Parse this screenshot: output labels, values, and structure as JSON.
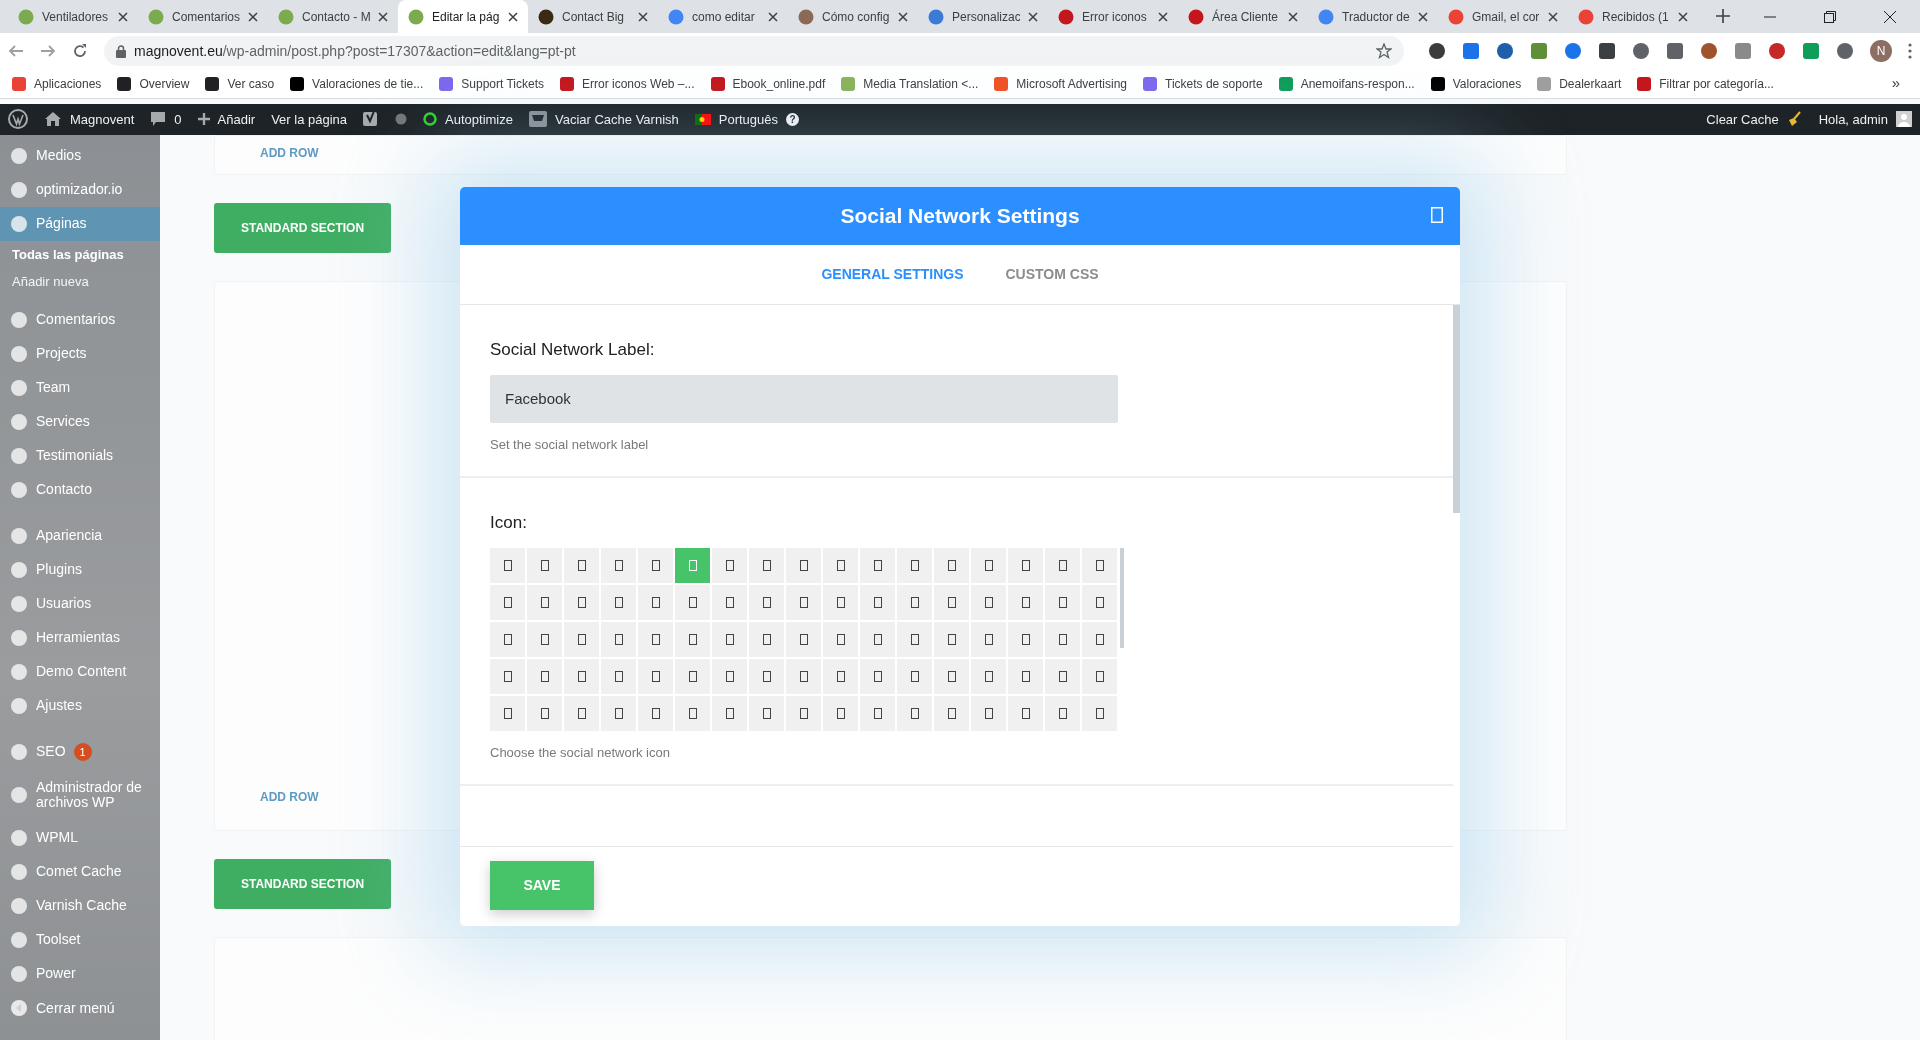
{
  "browser": {
    "tabs": [
      {
        "title": "Ventiladores",
        "selected": false,
        "color": "#7cab4f"
      },
      {
        "title": "Comentarios",
        "selected": false,
        "color": "#7cab4f"
      },
      {
        "title": "Contacto - M",
        "selected": false,
        "color": "#7cab4f"
      },
      {
        "title": "Editar la pág",
        "selected": true,
        "color": "#7cab4f"
      },
      {
        "title": "Contact Big",
        "selected": false,
        "color": "#3b2a12"
      },
      {
        "title": "como editar",
        "selected": false,
        "color": "#4285f4"
      },
      {
        "title": "Cómo config",
        "selected": false,
        "color": "#8a6a55"
      },
      {
        "title": "Personalizac",
        "selected": false,
        "color": "#3a7bd5"
      },
      {
        "title": "Error iconos",
        "selected": false,
        "color": "#c4161c"
      },
      {
        "title": "Área Cliente",
        "selected": false,
        "color": "#c4161c"
      },
      {
        "title": "Traductor de",
        "selected": false,
        "color": "#4285f4"
      },
      {
        "title": "Gmail, el cor",
        "selected": false,
        "color": "#ea4335"
      },
      {
        "title": "Recibidos (1",
        "selected": false,
        "color": "#ea4335"
      }
    ],
    "address": {
      "domain": "magnovent.eu",
      "path": "/wp-admin/post.php?post=17307&action=edit&lang=pt-pt"
    },
    "profile_initial": "N",
    "bookmarks": [
      {
        "label": "Aplicaciones",
        "color": "#ea4335"
      },
      {
        "label": "Overview",
        "color": "#202124"
      },
      {
        "label": "Ver caso",
        "color": "#202124"
      },
      {
        "label": "Valoraciones de tie...",
        "color": "#000000"
      },
      {
        "label": "Support Tickets",
        "color": "#7b68ee"
      },
      {
        "label": "Error iconos Web –...",
        "color": "#c4161c"
      },
      {
        "label": "Ebook_online.pdf",
        "color": "#c4161c"
      },
      {
        "label": "Media Translation <...",
        "color": "#8bb35a"
      },
      {
        "label": "Microsoft Advertising",
        "color": "#f25022"
      },
      {
        "label": "Tickets de soporte",
        "color": "#7b68ee"
      },
      {
        "label": "Anemoifans-respon...",
        "color": "#0f9d58"
      },
      {
        "label": "Valoraciones",
        "color": "#000000"
      },
      {
        "label": "Dealerkaart",
        "color": "#9e9e9e"
      },
      {
        "label": "Filtrar por categoría...",
        "color": "#c4161c"
      }
    ],
    "bookmarks_more": "»"
  },
  "admin_bar": {
    "site": "Magnovent",
    "comments": "0",
    "new": "Añadir",
    "view": "Ver la página",
    "autoptimize": "Autoptimize",
    "varnish": "Vaciar Cache Varnish",
    "language": "Português",
    "help": "?",
    "clear_cache": "Clear Cache",
    "greeting": "Hola, admin"
  },
  "sidebar": {
    "groups": [
      [
        {
          "label": "Medios",
          "selected": false
        },
        {
          "label": "optimizador.io",
          "selected": false
        },
        {
          "label": "Páginas",
          "selected": true,
          "children": [
            {
              "label": "Todas las páginas",
              "selected": true
            },
            {
              "label": "Añadir nueva",
              "selected": false
            }
          ]
        },
        {
          "label": "Comentarios",
          "selected": false
        },
        {
          "label": "Projects",
          "selected": false
        },
        {
          "label": "Team",
          "selected": false
        },
        {
          "label": "Services",
          "selected": false
        },
        {
          "label": "Testimonials",
          "selected": false
        },
        {
          "label": "Contacto",
          "selected": false
        }
      ],
      [
        {
          "label": "Apariencia",
          "selected": false
        },
        {
          "label": "Plugins",
          "selected": false
        },
        {
          "label": "Usuarios",
          "selected": false
        },
        {
          "label": "Herramientas",
          "selected": false
        },
        {
          "label": "Demo Content",
          "selected": false
        },
        {
          "label": "Ajustes",
          "selected": false
        }
      ],
      [
        {
          "label": "SEO",
          "selected": false,
          "badge": "1"
        },
        {
          "label": "Administrador de archivos WP",
          "selected": false
        },
        {
          "label": "WPML",
          "selected": false
        },
        {
          "label": "Comet Cache",
          "selected": false
        },
        {
          "label": "Varnish Cache",
          "selected": false
        },
        {
          "label": "Toolset",
          "selected": false
        },
        {
          "label": "Power",
          "selected": false
        }
      ]
    ],
    "collapse": "Cerrar menú"
  },
  "builder": {
    "items": [
      {
        "kind": "row_card",
        "label": "ADD ROW"
      },
      {
        "kind": "section_button",
        "label": "STANDARD SECTION"
      },
      {
        "kind": "section_card",
        "label": "ADD ROW"
      },
      {
        "kind": "section_button",
        "label": "STANDARD SECTION"
      },
      {
        "kind": "empty_card"
      }
    ]
  },
  "modal": {
    "title": "Social Network Settings",
    "tabs": [
      {
        "label": "GENERAL SETTINGS",
        "selected": true
      },
      {
        "label": "CUSTOM CSS",
        "selected": false
      }
    ],
    "fields": [
      {
        "kind": "text",
        "label": "Social Network Label:",
        "value": "Facebook",
        "hint": "Set the social network label"
      },
      {
        "kind": "icon_picker",
        "label": "Icon:",
        "hint": "Choose the social network icon",
        "rows": [
          [
            {
              "selected": false
            },
            {
              "selected": false
            },
            {
              "selected": false
            },
            {
              "selected": false
            },
            {
              "selected": false
            },
            {
              "selected": true
            },
            {
              "selected": false
            },
            {
              "selected": false
            },
            {
              "selected": false
            },
            {
              "selected": false
            },
            {
              "selected": false
            },
            {
              "selected": false
            },
            {
              "selected": false
            },
            {
              "selected": false
            },
            {
              "selected": false
            },
            {
              "selected": false
            },
            {
              "selected": false
            }
          ],
          [
            {
              "selected": false
            },
            {
              "selected": false
            },
            {
              "selected": false
            },
            {
              "selected": false
            },
            {
              "selected": false
            },
            {
              "selected": false
            },
            {
              "selected": false
            },
            {
              "selected": false
            },
            {
              "selected": false
            },
            {
              "selected": false
            },
            {
              "selected": false
            },
            {
              "selected": false
            },
            {
              "selected": false
            },
            {
              "selected": false
            },
            {
              "selected": false
            },
            {
              "selected": false
            },
            {
              "selected": false
            }
          ],
          [
            {
              "selected": false
            },
            {
              "selected": false
            },
            {
              "selected": false
            },
            {
              "selected": false
            },
            {
              "selected": false
            },
            {
              "selected": false
            },
            {
              "selected": false
            },
            {
              "selected": false
            },
            {
              "selected": false
            },
            {
              "selected": false
            },
            {
              "selected": false
            },
            {
              "selected": false
            },
            {
              "selected": false
            },
            {
              "selected": false
            },
            {
              "selected": false
            },
            {
              "selected": false
            },
            {
              "selected": false
            }
          ],
          [
            {
              "selected": false
            },
            {
              "selected": false
            },
            {
              "selected": false
            },
            {
              "selected": false
            },
            {
              "selected": false
            },
            {
              "selected": false
            },
            {
              "selected": false
            },
            {
              "selected": false
            },
            {
              "selected": false
            },
            {
              "selected": false
            },
            {
              "selected": false
            },
            {
              "selected": false
            },
            {
              "selected": false
            },
            {
              "selected": false
            },
            {
              "selected": false
            },
            {
              "selected": false
            },
            {
              "selected": false
            }
          ],
          [
            {
              "selected": false
            },
            {
              "selected": false
            },
            {
              "selected": false
            },
            {
              "selected": false
            },
            {
              "selected": false
            },
            {
              "selected": false
            },
            {
              "selected": false
            },
            {
              "selected": false
            },
            {
              "selected": false
            },
            {
              "selected": false
            },
            {
              "selected": false
            },
            {
              "selected": false
            },
            {
              "selected": false
            },
            {
              "selected": false
            },
            {
              "selected": false
            },
            {
              "selected": false
            },
            {
              "selected": false
            }
          ]
        ]
      }
    ],
    "save": "SAVE"
  }
}
